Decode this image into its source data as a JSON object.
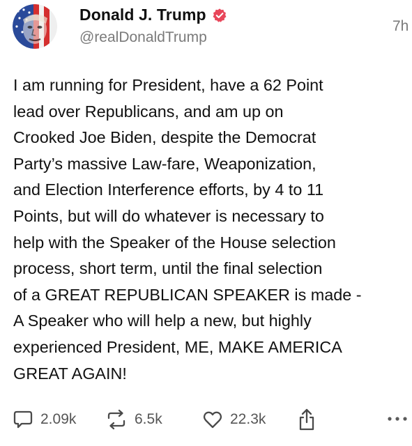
{
  "post": {
    "author": {
      "display_name": "Donald J. Trump",
      "handle": "@realDonaldTrump",
      "verified": true,
      "verified_badge_color": "#e8465a"
    },
    "timestamp": "7h",
    "text": "I am running for President, have a 62 Point\nlead over Republicans, and am up on\nCrooked Joe Biden, despite the Democrat\nParty’s massive Law-fare, Weaponization,\nand Election Interference efforts, by 4 to 11\nPoints, but will do whatever is necessary to\nhelp with the Speaker of the House selection\nprocess, short term, until the final selection\nof a GREAT REPUBLICAN SPEAKER is made -\nA Speaker who will help a new, but highly\nexperienced President, ME, MAKE AMERICA\nGREAT AGAIN!",
    "actions": {
      "replies": {
        "icon": "comment-icon",
        "count": "2.09k"
      },
      "reposts": {
        "icon": "repost-icon",
        "count": "6.5k"
      },
      "likes": {
        "icon": "heart-icon",
        "count": "22.3k"
      },
      "share": {
        "icon": "share-icon"
      },
      "more": {
        "icon": "more-dots-icon"
      }
    }
  }
}
